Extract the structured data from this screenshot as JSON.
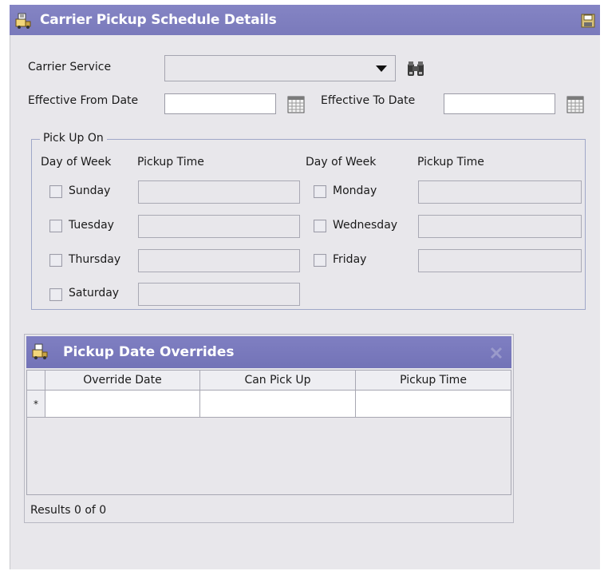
{
  "header": {
    "title": "Carrier Pickup Schedule Details",
    "title_icon": "truck-schedule-icon",
    "save_icon": "save-icon"
  },
  "form": {
    "carrier_service_label": "Carrier Service",
    "carrier_service_value": "",
    "effective_from_label": "Effective From Date",
    "effective_from_value": "",
    "effective_to_label": "Effective To Date",
    "effective_to_value": ""
  },
  "pickup": {
    "group_label": "Pick Up On",
    "day_header": "Day of Week",
    "time_header": "Pickup Time",
    "days": [
      {
        "label": "Sunday",
        "checked": false,
        "time": ""
      },
      {
        "label": "Monday",
        "checked": false,
        "time": ""
      },
      {
        "label": "Tuesday",
        "checked": false,
        "time": ""
      },
      {
        "label": "Wednesday",
        "checked": false,
        "time": ""
      },
      {
        "label": "Thursday",
        "checked": false,
        "time": ""
      },
      {
        "label": "Friday",
        "checked": false,
        "time": ""
      },
      {
        "label": "Saturday",
        "checked": false,
        "time": ""
      }
    ]
  },
  "overrides": {
    "title": "Pickup Date Overrides",
    "columns": [
      "Override Date",
      "Can Pick Up",
      "Pickup Time"
    ],
    "new_row_marker": "*",
    "results": "Results 0 of 0"
  },
  "colors": {
    "titlebar": "#7a7abb",
    "panel": "#e8e7eb"
  }
}
